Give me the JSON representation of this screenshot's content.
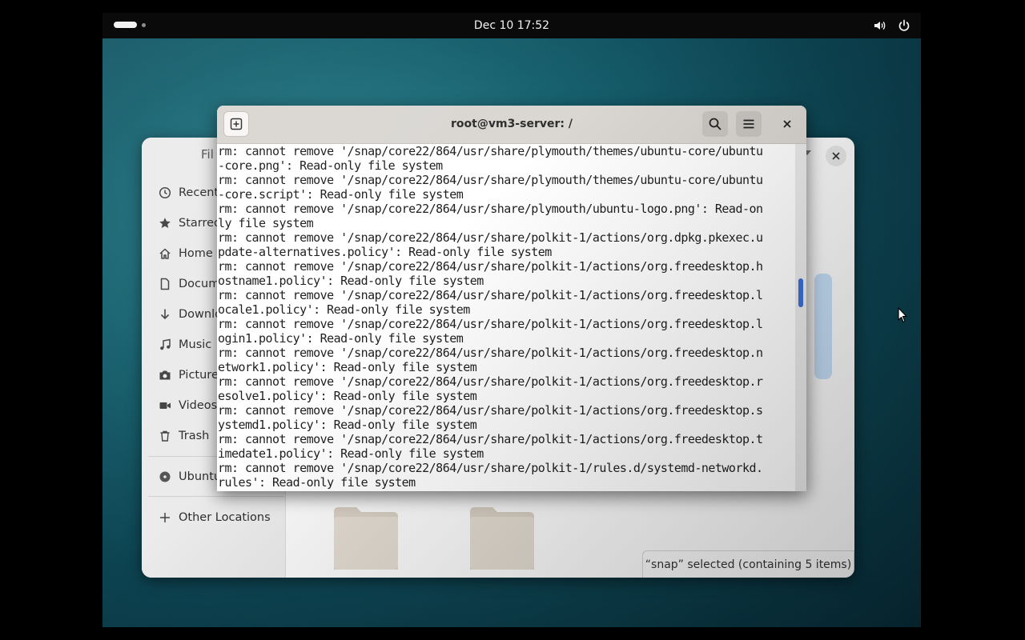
{
  "topbar": {
    "clock": "Dec 10  17:52",
    "icons": [
      "activities-indicator",
      "volume-icon",
      "power-icon"
    ]
  },
  "files_window": {
    "title_partial": "Fil",
    "sidebar": {
      "items": [
        {
          "label": "Recent",
          "icon": "clock-icon"
        },
        {
          "label": "Starred",
          "icon": "star-icon"
        },
        {
          "label": "Home",
          "icon": "home-icon"
        },
        {
          "label": "Docume",
          "icon": "document-icon"
        },
        {
          "label": "Downlo",
          "icon": "download-icon"
        },
        {
          "label": "Music",
          "icon": "music-icon"
        },
        {
          "label": "Pictures",
          "icon": "camera-icon"
        },
        {
          "label": "Videos",
          "icon": "video-icon"
        },
        {
          "label": "Trash",
          "icon": "trash-icon"
        }
      ],
      "drive": {
        "label": "Ubuntu-",
        "icon": "disc-icon"
      },
      "other": {
        "label": "Other Locations",
        "icon": "plus-icon"
      }
    },
    "status_text": "“snap” selected  (containing 5 items)"
  },
  "terminal": {
    "title": "root@vm3-server: /",
    "lines": [
      "rm: cannot remove '/snap/core22/864/usr/share/plymouth/themes/ubuntu-core/ubuntu",
      "-core.png': Read-only file system",
      "rm: cannot remove '/snap/core22/864/usr/share/plymouth/themes/ubuntu-core/ubuntu",
      "-core.script': Read-only file system",
      "rm: cannot remove '/snap/core22/864/usr/share/plymouth/ubuntu-logo.png': Read-on",
      "ly file system",
      "rm: cannot remove '/snap/core22/864/usr/share/polkit-1/actions/org.dpkg.pkexec.u",
      "pdate-alternatives.policy': Read-only file system",
      "rm: cannot remove '/snap/core22/864/usr/share/polkit-1/actions/org.freedesktop.h",
      "ostname1.policy': Read-only file system",
      "rm: cannot remove '/snap/core22/864/usr/share/polkit-1/actions/org.freedesktop.l",
      "ocale1.policy': Read-only file system",
      "rm: cannot remove '/snap/core22/864/usr/share/polkit-1/actions/org.freedesktop.l",
      "ogin1.policy': Read-only file system",
      "rm: cannot remove '/snap/core22/864/usr/share/polkit-1/actions/org.freedesktop.n",
      "etwork1.policy': Read-only file system",
      "rm: cannot remove '/snap/core22/864/usr/share/polkit-1/actions/org.freedesktop.r",
      "esolve1.policy': Read-only file system",
      "rm: cannot remove '/snap/core22/864/usr/share/polkit-1/actions/org.freedesktop.s",
      "ystemd1.policy': Read-only file system",
      "rm: cannot remove '/snap/core22/864/usr/share/polkit-1/actions/org.freedesktop.t",
      "imedate1.policy': Read-only file system",
      "rm: cannot remove '/snap/core22/864/usr/share/polkit-1/rules.d/systemd-networkd.",
      "rules': Read-only file system"
    ]
  },
  "colors": {
    "accent": "#3c6fd9",
    "terminal_header": "#dad7d3",
    "selection": "#c5def6"
  }
}
